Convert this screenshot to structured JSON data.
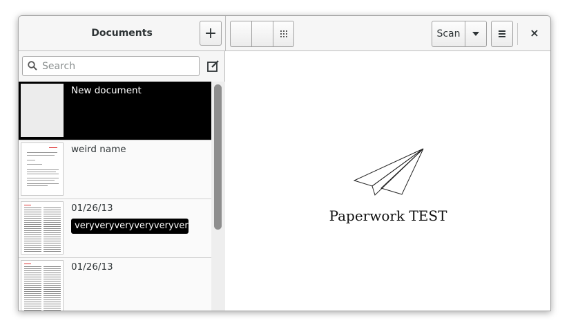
{
  "header": {
    "title": "Documents",
    "add_label": "+",
    "scan_label": "Scan",
    "close_label": "×"
  },
  "search": {
    "placeholder": "Search",
    "value": ""
  },
  "documents": [
    {
      "name": "New document",
      "selected": true,
      "label": ""
    },
    {
      "name": "weird name",
      "selected": false,
      "label": ""
    },
    {
      "name": "01/26/13",
      "selected": false,
      "label": "veryveryveryveryveryveryveryvery"
    },
    {
      "name": "01/26/13",
      "selected": false,
      "label": ""
    }
  ],
  "main": {
    "app_label": "Paperwork TEST"
  },
  "icons": {
    "search": "search-icon",
    "edit": "edit-icon",
    "grid_view": "grid-view-icon",
    "dropdown": "chevron-down-icon",
    "menu": "menu-icon",
    "plane": "paper-plane-icon"
  },
  "colors": {
    "selected_bg": "#000000",
    "selected_fg": "#ffffff",
    "header_bg": "#f6f6f6"
  }
}
